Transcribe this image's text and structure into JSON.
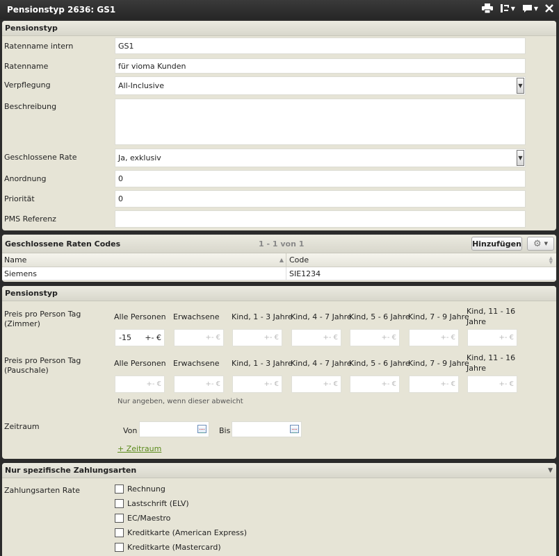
{
  "window": {
    "title": "Pensionstyp 2636: GS1"
  },
  "section1": {
    "title": "Pensionstyp",
    "fields": {
      "ratenname_intern": {
        "label": "Ratenname intern",
        "value": "GS1"
      },
      "ratenname": {
        "label": "Ratenname",
        "value": "für vioma Kunden"
      },
      "verpflegung": {
        "label": "Verpflegung",
        "value": "All-Inclusive"
      },
      "beschreibung": {
        "label": "Beschreibung",
        "value": ""
      },
      "geschlossene_rate": {
        "label": "Geschlossene Rate",
        "value": "Ja, exklusiv"
      },
      "anordnung": {
        "label": "Anordnung",
        "value": "0"
      },
      "prioritaet": {
        "label": "Priorität",
        "value": "0"
      },
      "pms_referenz": {
        "label": "PMS Referenz",
        "value": ""
      }
    }
  },
  "section2": {
    "title": "Geschlossene Raten Codes",
    "pagination": "1 - 1 von 1",
    "add_button": "Hinzufügen",
    "columns": {
      "name": "Name",
      "code": "Code"
    },
    "rows": [
      {
        "name": "Siemens",
        "code": "SIE1234"
      }
    ]
  },
  "section3": {
    "title": "Pensionstyp",
    "zimmer_label": "Preis pro Person Tag (Zimmer)",
    "pauschale_label": "Preis pro Person Tag (Pauschale)",
    "columns": [
      "Alle Personen",
      "Erwachsene",
      "Kind, 1 - 3 Jahre",
      "Kind, 4 - 7 Jahre",
      "Kind, 5 - 6 Jahre",
      "Kind, 7 - 9 Jahre",
      "Kind, 11 - 16 Jahre"
    ],
    "zimmer_values": [
      "-15",
      "",
      "",
      "",
      "",
      "",
      ""
    ],
    "suffix": "+- €",
    "hint": "Nur angeben, wenn dieser abweicht",
    "zeitraum": {
      "label": "Zeitraum",
      "von": "Von",
      "bis": "Bis",
      "add_link": "+ Zeitraum"
    }
  },
  "section4": {
    "title": "Nur spezifische Zahlungsarten",
    "label": "Zahlungsarten Rate",
    "options": [
      "Rechnung",
      "Lastschrift (ELV)",
      "EC/Maestro",
      "Kreditkarte (American Express)",
      "Kreditkarte (Mastercard)"
    ]
  }
}
